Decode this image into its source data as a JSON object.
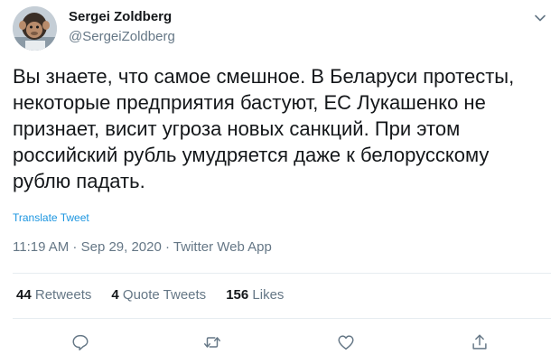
{
  "author": {
    "name": "Sergei Zoldberg",
    "handle": "@SergeiZoldberg"
  },
  "tweet": {
    "text": "Вы знаете, что самое смешное. В Беларуси протесты, некоторые предприятия бастуют, ЕС Лукашенко не признает, висит угроза новых санкций. При этом российский рубль умудряется даже к белорусскому рублю падать.",
    "translate_label": "Translate Tweet",
    "meta": "11:19 AM · Sep 29, 2020 · Twitter Web App"
  },
  "stats": {
    "retweets": {
      "count": "44",
      "label": "Retweets"
    },
    "quotes": {
      "count": "4",
      "label": "Quote Tweets"
    },
    "likes": {
      "count": "156",
      "label": "Likes"
    }
  },
  "icons": {
    "more": "chevron-down-icon",
    "reply": "reply-icon",
    "retweet": "retweet-icon",
    "like": "heart-icon",
    "share": "share-icon"
  },
  "colors": {
    "link": "#1b95e0",
    "secondary": "#657786",
    "divider": "#e6ecf0"
  }
}
